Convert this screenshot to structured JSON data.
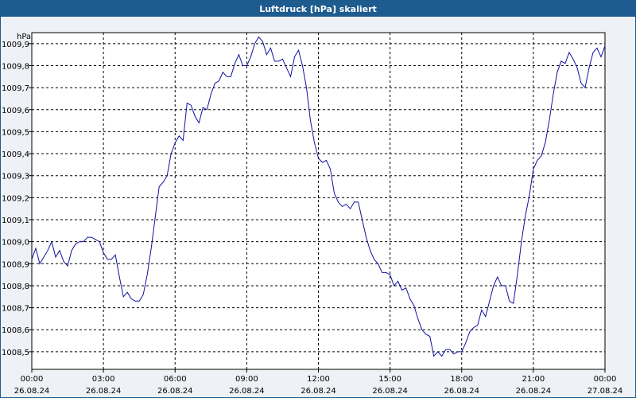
{
  "window": {
    "title": "Luftdruck [hPa] skaliert"
  },
  "chart_data": {
    "type": "line",
    "title": "Luftdruck [hPa] skaliert",
    "ylabel": "hPa",
    "xlabel": "",
    "ylim": [
      1008.42,
      1009.95
    ],
    "grid": true,
    "legend": "none",
    "colors": {
      "line": "#1010a0",
      "grid": "#000000",
      "plot_bg": "#ffffff"
    },
    "y_ticks": [
      "1008,5",
      "1008,6",
      "1008,7",
      "1008,8",
      "1008,9",
      "1009,0",
      "1009,1",
      "1009,2",
      "1009,3",
      "1009,4",
      "1009,5",
      "1009,6",
      "1009,7",
      "1009,8",
      "1009,9"
    ],
    "x_ticks": [
      {
        "time": "00:00",
        "date": "26.08.24"
      },
      {
        "time": "03:00",
        "date": "26.08.24"
      },
      {
        "time": "06:00",
        "date": "26.08.24"
      },
      {
        "time": "09:00",
        "date": "26.08.24"
      },
      {
        "time": "12:00",
        "date": "26.08.24"
      },
      {
        "time": "15:00",
        "date": "26.08.24"
      },
      {
        "time": "18:00",
        "date": "26.08.24"
      },
      {
        "time": "21:00",
        "date": "26.08.24"
      },
      {
        "time": "00:00",
        "date": "27.08.24"
      }
    ],
    "series": [
      {
        "x": [
          "00:00",
          "00:10",
          "00:20",
          "00:30",
          "00:40",
          "00:50",
          "01:00",
          "01:10",
          "01:20",
          "01:30",
          "01:40",
          "01:50",
          "02:00",
          "02:10",
          "02:20",
          "02:30",
          "02:40",
          "02:50",
          "03:00",
          "03:10",
          "03:20",
          "03:30",
          "03:40",
          "03:50",
          "04:00",
          "04:10",
          "04:20",
          "04:30",
          "04:40",
          "04:50",
          "05:00",
          "05:10",
          "05:20",
          "05:30",
          "05:40",
          "05:50",
          "06:00",
          "06:10",
          "06:20",
          "06:30",
          "06:40",
          "06:50",
          "07:00",
          "07:10",
          "07:20",
          "07:30",
          "07:40",
          "07:50",
          "08:00",
          "08:10",
          "08:20",
          "08:30",
          "08:40",
          "08:50",
          "09:00",
          "09:10",
          "09:20",
          "09:30",
          "09:40",
          "09:50",
          "10:00",
          "10:10",
          "10:20",
          "10:30",
          "10:40",
          "10:50",
          "11:00",
          "11:10",
          "11:20",
          "11:30",
          "11:40",
          "11:50",
          "12:00",
          "12:10",
          "12:20",
          "12:30",
          "12:40",
          "12:50",
          "13:00",
          "13:10",
          "13:20",
          "13:30",
          "13:40",
          "13:50",
          "14:00",
          "14:10",
          "14:20",
          "14:30",
          "14:40",
          "14:50",
          "15:00",
          "15:10",
          "15:20",
          "15:30",
          "15:40",
          "15:50",
          "16:00",
          "16:10",
          "16:20",
          "16:30",
          "16:40",
          "16:50",
          "17:00",
          "17:10",
          "17:20",
          "17:30",
          "17:40",
          "17:50",
          "18:00",
          "18:10",
          "18:20",
          "18:30",
          "18:40",
          "18:50",
          "19:00",
          "19:10",
          "19:20",
          "19:30",
          "19:40",
          "19:50",
          "20:00",
          "20:10",
          "20:20",
          "20:30",
          "20:40",
          "20:50",
          "21:00",
          "21:10",
          "21:20",
          "21:30",
          "21:40",
          "21:50",
          "22:00",
          "22:10",
          "22:20",
          "22:30",
          "22:40",
          "22:50",
          "23:00",
          "23:10",
          "23:20",
          "23:30",
          "23:40",
          "23:50",
          "24:00"
        ],
        "values": [
          1008.92,
          1008.97,
          1008.9,
          1008.93,
          1008.96,
          1009.0,
          1008.93,
          1008.96,
          1008.91,
          1008.89,
          1008.96,
          1008.99,
          1009.0,
          1009.0,
          1009.02,
          1009.02,
          1009.01,
          1009.0,
          1008.95,
          1008.92,
          1008.92,
          1008.94,
          1008.84,
          1008.75,
          1008.77,
          1008.74,
          1008.73,
          1008.73,
          1008.76,
          1008.85,
          1008.97,
          1009.11,
          1009.25,
          1009.27,
          1009.3,
          1009.4,
          1009.45,
          1009.48,
          1009.46,
          1009.63,
          1009.62,
          1009.57,
          1009.54,
          1009.61,
          1009.6,
          1009.67,
          1009.72,
          1009.73,
          1009.77,
          1009.75,
          1009.75,
          1009.81,
          1009.85,
          1009.8,
          1009.8,
          1009.84,
          1009.9,
          1009.93,
          1009.91,
          1009.85,
          1009.88,
          1009.82,
          1009.82,
          1009.83,
          1009.79,
          1009.75,
          1009.84,
          1009.87,
          1009.8,
          1009.7,
          1009.55,
          1009.45,
          1009.38,
          1009.36,
          1009.37,
          1009.33,
          1009.22,
          1009.18,
          1009.16,
          1009.17,
          1009.15,
          1009.18,
          1009.18,
          1009.1,
          1009.02,
          1008.96,
          1008.92,
          1008.9,
          1008.86,
          1008.86,
          1008.85,
          1008.8,
          1008.82,
          1008.78,
          1008.79,
          1008.74,
          1008.71,
          1008.65,
          1008.6,
          1008.58,
          1008.57,
          1008.48,
          1008.5,
          1008.48,
          1008.51,
          1008.51,
          1008.49,
          1008.5,
          1008.5,
          1008.54,
          1008.59,
          1008.61,
          1008.62,
          1008.69,
          1008.66,
          1008.73,
          1008.8,
          1008.84,
          1008.8,
          1008.8,
          1008.73,
          1008.72,
          1008.85,
          1009.0,
          1009.12,
          1009.21,
          1009.33,
          1009.37,
          1009.39,
          1009.45,
          1009.55,
          1009.67,
          1009.77,
          1009.82,
          1009.81,
          1009.86,
          1009.83,
          1009.79,
          1009.72,
          1009.7,
          1009.79,
          1009.86,
          1009.88,
          1009.84,
          1009.89
        ]
      }
    ]
  }
}
